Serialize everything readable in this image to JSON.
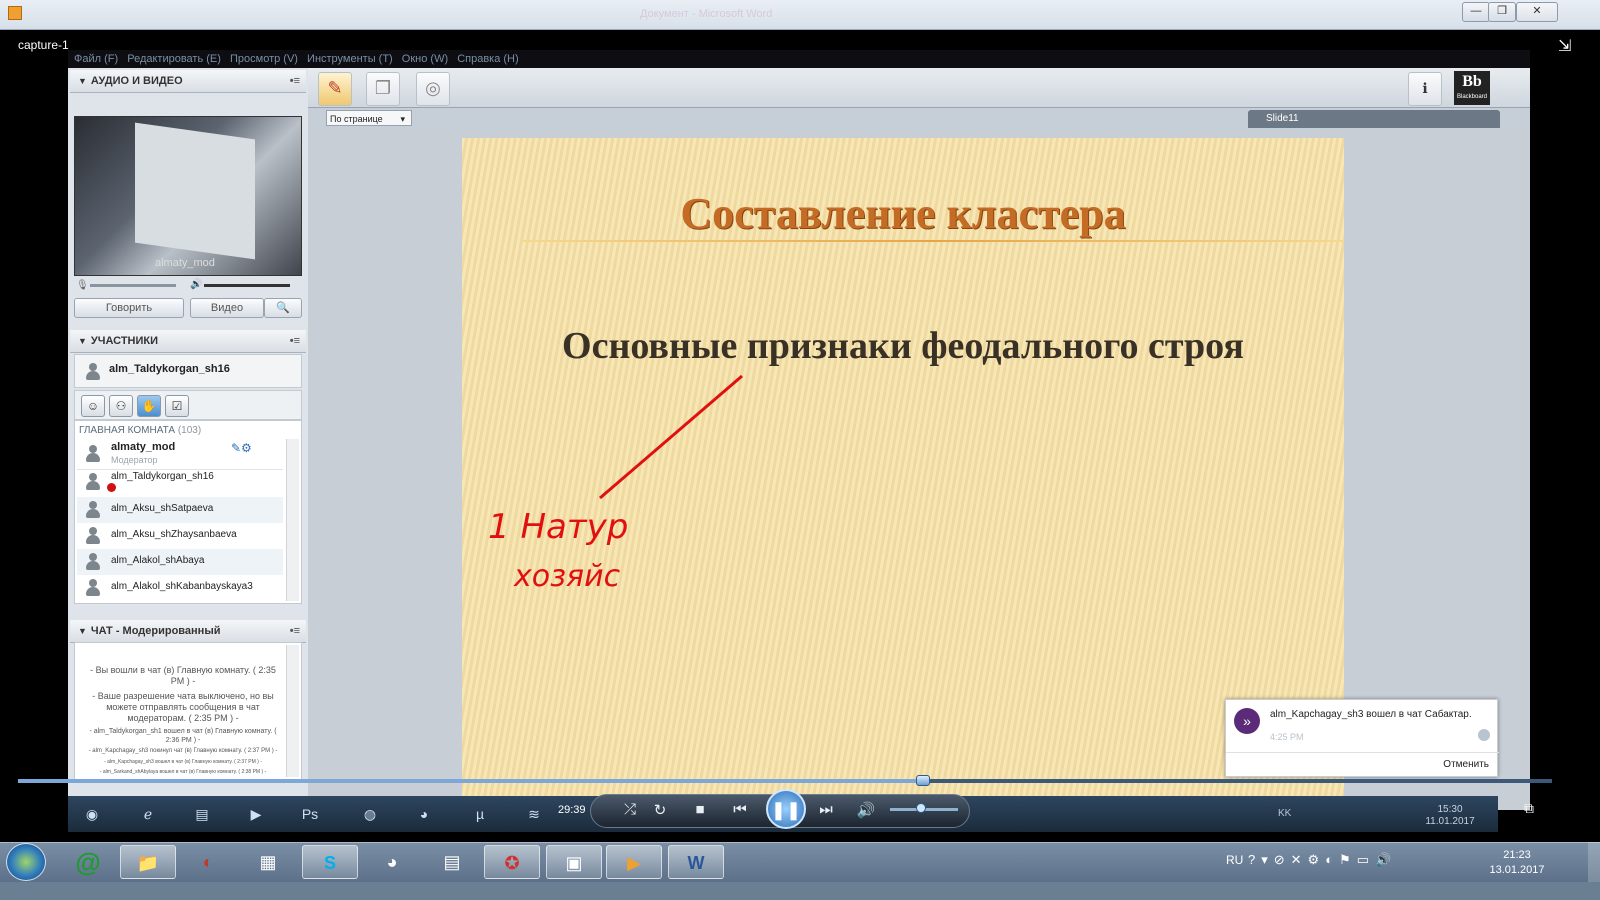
{
  "window": {
    "title_faded": "Документ - Microsoft Word",
    "player_label": "capture-1",
    "min": "—",
    "max": "❐",
    "close": "✕"
  },
  "app": {
    "menu": [
      "Файл (F)",
      "Редактировать (E)",
      "Просмотр (V)",
      "Инструменты (T)",
      "Окно (W)",
      "Справка (H)"
    ],
    "audio_video": {
      "header": "АУДИО И ВИДЕО",
      "video_label": "almaty_mod",
      "talk_button": "Говорить",
      "video_button": "Видео"
    },
    "participants": {
      "header": "УЧАСТНИКИ",
      "self_name": "alm_Taldykorgan_sh16",
      "room_label": "ГЛАВНАЯ КОМНАТА",
      "room_count": "(103)",
      "moderator": {
        "name": "almaty_mod",
        "role": "Модератор"
      },
      "list": [
        "alm_Taldykorgan_sh16",
        "alm_Aksu_shSatpaeva",
        "alm_Aksu_shZhaysanbaeva",
        "alm_Alakol_shAbaya",
        "alm_Alakol_shKabanbayskaya3"
      ]
    },
    "chat": {
      "header": "ЧАТ - Модерированный",
      "messages": [
        "- Вы вошли в чат (в) Главную комнату. ( 2:35 PM ) -",
        "- Ваше разрешение чата выключено, но вы можете отправлять сообщения в чат модераторам. ( 2:35 PM ) -",
        "- alm_Taldykorgan_sh1 вошел в чат (в) Главную комнату. ( 2:36 PM ) -",
        "- alm_Kapchagay_sh3 покинул чат (в) Главную комнату. ( 2:37 PM ) -",
        "- alm_Kapchagay_sh3 вошел в чат (в) Главную комнату. ( 2:37 PM ) -",
        "- alm_Sarkand_shAbylaya вошел в чат (в) Главную комнату. ( 2:38 PM ) -"
      ]
    },
    "view": {
      "page_select": "По странице",
      "slide_tab": "Slide11",
      "bb_logo": "Bb",
      "bb_sub": "Blackboard"
    },
    "slide": {
      "title": "Составление кластера",
      "subtitle": "Основные признаки феодального строя",
      "ink_line1": "1 Натур",
      "ink_line2": "хозяйс"
    },
    "toast": {
      "message": "alm_Kapchagay_sh3 вошел в чат Сабактар.",
      "time": "4:25 PM",
      "cancel": "Отменить"
    }
  },
  "media": {
    "elapsed": "29:39",
    "progress_fraction": 0.59,
    "volume_fraction": 0.45,
    "inner_clock_time": "15:30",
    "inner_clock_date": "11.01.2017",
    "inner_lang": "KK"
  },
  "taskbar": {
    "lang": "RU",
    "time": "21:23",
    "date": "13.01.2017"
  }
}
